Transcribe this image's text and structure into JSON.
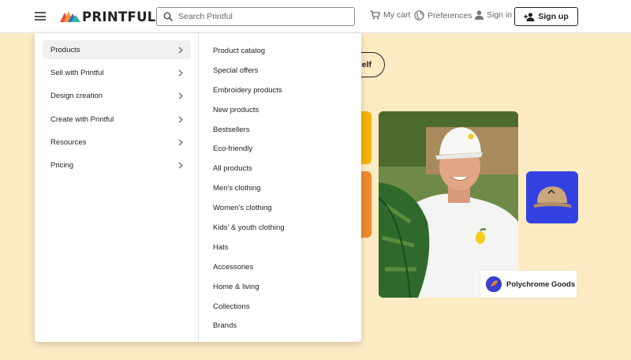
{
  "header": {
    "logo_text": "PRINTFUL",
    "search_placeholder": "Search Printful",
    "cart_label": "My cart",
    "preferences_label": "Preferences",
    "signin_label": "Sign in",
    "signup_label": "Sign up"
  },
  "hero": {
    "button_label": "self",
    "brand_card_label": "Polychrome Goods"
  },
  "menu": {
    "left_items": [
      {
        "label": "Products"
      },
      {
        "label": "Sell with Printful"
      },
      {
        "label": "Design creation"
      },
      {
        "label": "Create with Printful"
      },
      {
        "label": "Resources"
      },
      {
        "label": "Pricing"
      }
    ],
    "right_items": [
      {
        "label": "Product catalog"
      },
      {
        "label": "Special offers"
      },
      {
        "label": "Embroidery products"
      },
      {
        "label": "New products"
      },
      {
        "label": "Bestsellers"
      },
      {
        "label": "Eco-friendly"
      },
      {
        "label": "All products"
      },
      {
        "label": "Men's clothing"
      },
      {
        "label": "Women's clothing"
      },
      {
        "label": "Kids' & youth clothing"
      },
      {
        "label": "Hats"
      },
      {
        "label": "Accessories"
      },
      {
        "label": "Home & living"
      },
      {
        "label": "Collections"
      },
      {
        "label": "Brands"
      }
    ]
  },
  "colors": {
    "page_background": "#fdebc4",
    "accent_yellow": "#f6b20c",
    "accent_orange": "#f08a2c",
    "accent_blue": "#3341e0"
  }
}
